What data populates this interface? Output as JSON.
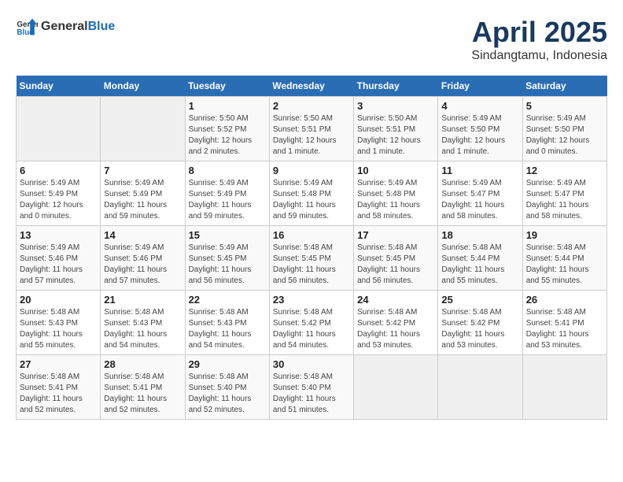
{
  "header": {
    "logo": {
      "general": "General",
      "blue": "Blue"
    },
    "title": "April 2025",
    "subtitle": "Sindangtamu, Indonesia"
  },
  "weekdays": [
    "Sunday",
    "Monday",
    "Tuesday",
    "Wednesday",
    "Thursday",
    "Friday",
    "Saturday"
  ],
  "weeks": [
    [
      {
        "day": "",
        "empty": true
      },
      {
        "day": "",
        "empty": true
      },
      {
        "day": "1",
        "sunrise": "Sunrise: 5:50 AM",
        "sunset": "Sunset: 5:52 PM",
        "daylight": "Daylight: 12 hours and 2 minutes."
      },
      {
        "day": "2",
        "sunrise": "Sunrise: 5:50 AM",
        "sunset": "Sunset: 5:51 PM",
        "daylight": "Daylight: 12 hours and 1 minute."
      },
      {
        "day": "3",
        "sunrise": "Sunrise: 5:50 AM",
        "sunset": "Sunset: 5:51 PM",
        "daylight": "Daylight: 12 hours and 1 minute."
      },
      {
        "day": "4",
        "sunrise": "Sunrise: 5:49 AM",
        "sunset": "Sunset: 5:50 PM",
        "daylight": "Daylight: 12 hours and 1 minute."
      },
      {
        "day": "5",
        "sunrise": "Sunrise: 5:49 AM",
        "sunset": "Sunset: 5:50 PM",
        "daylight": "Daylight: 12 hours and 0 minutes."
      }
    ],
    [
      {
        "day": "6",
        "sunrise": "Sunrise: 5:49 AM",
        "sunset": "Sunset: 5:49 PM",
        "daylight": "Daylight: 12 hours and 0 minutes."
      },
      {
        "day": "7",
        "sunrise": "Sunrise: 5:49 AM",
        "sunset": "Sunset: 5:49 PM",
        "daylight": "Daylight: 11 hours and 59 minutes."
      },
      {
        "day": "8",
        "sunrise": "Sunrise: 5:49 AM",
        "sunset": "Sunset: 5:49 PM",
        "daylight": "Daylight: 11 hours and 59 minutes."
      },
      {
        "day": "9",
        "sunrise": "Sunrise: 5:49 AM",
        "sunset": "Sunset: 5:48 PM",
        "daylight": "Daylight: 11 hours and 59 minutes."
      },
      {
        "day": "10",
        "sunrise": "Sunrise: 5:49 AM",
        "sunset": "Sunset: 5:48 PM",
        "daylight": "Daylight: 11 hours and 58 minutes."
      },
      {
        "day": "11",
        "sunrise": "Sunrise: 5:49 AM",
        "sunset": "Sunset: 5:47 PM",
        "daylight": "Daylight: 11 hours and 58 minutes."
      },
      {
        "day": "12",
        "sunrise": "Sunrise: 5:49 AM",
        "sunset": "Sunset: 5:47 PM",
        "daylight": "Daylight: 11 hours and 58 minutes."
      }
    ],
    [
      {
        "day": "13",
        "sunrise": "Sunrise: 5:49 AM",
        "sunset": "Sunset: 5:46 PM",
        "daylight": "Daylight: 11 hours and 57 minutes."
      },
      {
        "day": "14",
        "sunrise": "Sunrise: 5:49 AM",
        "sunset": "Sunset: 5:46 PM",
        "daylight": "Daylight: 11 hours and 57 minutes."
      },
      {
        "day": "15",
        "sunrise": "Sunrise: 5:49 AM",
        "sunset": "Sunset: 5:45 PM",
        "daylight": "Daylight: 11 hours and 56 minutes."
      },
      {
        "day": "16",
        "sunrise": "Sunrise: 5:48 AM",
        "sunset": "Sunset: 5:45 PM",
        "daylight": "Daylight: 11 hours and 56 minutes."
      },
      {
        "day": "17",
        "sunrise": "Sunrise: 5:48 AM",
        "sunset": "Sunset: 5:45 PM",
        "daylight": "Daylight: 11 hours and 56 minutes."
      },
      {
        "day": "18",
        "sunrise": "Sunrise: 5:48 AM",
        "sunset": "Sunset: 5:44 PM",
        "daylight": "Daylight: 11 hours and 55 minutes."
      },
      {
        "day": "19",
        "sunrise": "Sunrise: 5:48 AM",
        "sunset": "Sunset: 5:44 PM",
        "daylight": "Daylight: 11 hours and 55 minutes."
      }
    ],
    [
      {
        "day": "20",
        "sunrise": "Sunrise: 5:48 AM",
        "sunset": "Sunset: 5:43 PM",
        "daylight": "Daylight: 11 hours and 55 minutes."
      },
      {
        "day": "21",
        "sunrise": "Sunrise: 5:48 AM",
        "sunset": "Sunset: 5:43 PM",
        "daylight": "Daylight: 11 hours and 54 minutes."
      },
      {
        "day": "22",
        "sunrise": "Sunrise: 5:48 AM",
        "sunset": "Sunset: 5:43 PM",
        "daylight": "Daylight: 11 hours and 54 minutes."
      },
      {
        "day": "23",
        "sunrise": "Sunrise: 5:48 AM",
        "sunset": "Sunset: 5:42 PM",
        "daylight": "Daylight: 11 hours and 54 minutes."
      },
      {
        "day": "24",
        "sunrise": "Sunrise: 5:48 AM",
        "sunset": "Sunset: 5:42 PM",
        "daylight": "Daylight: 11 hours and 53 minutes."
      },
      {
        "day": "25",
        "sunrise": "Sunrise: 5:48 AM",
        "sunset": "Sunset: 5:42 PM",
        "daylight": "Daylight: 11 hours and 53 minutes."
      },
      {
        "day": "26",
        "sunrise": "Sunrise: 5:48 AM",
        "sunset": "Sunset: 5:41 PM",
        "daylight": "Daylight: 11 hours and 53 minutes."
      }
    ],
    [
      {
        "day": "27",
        "sunrise": "Sunrise: 5:48 AM",
        "sunset": "Sunset: 5:41 PM",
        "daylight": "Daylight: 11 hours and 52 minutes."
      },
      {
        "day": "28",
        "sunrise": "Sunrise: 5:48 AM",
        "sunset": "Sunset: 5:41 PM",
        "daylight": "Daylight: 11 hours and 52 minutes."
      },
      {
        "day": "29",
        "sunrise": "Sunrise: 5:48 AM",
        "sunset": "Sunset: 5:40 PM",
        "daylight": "Daylight: 11 hours and 52 minutes."
      },
      {
        "day": "30",
        "sunrise": "Sunrise: 5:48 AM",
        "sunset": "Sunset: 5:40 PM",
        "daylight": "Daylight: 11 hours and 51 minutes."
      },
      {
        "day": "",
        "empty": true
      },
      {
        "day": "",
        "empty": true
      },
      {
        "day": "",
        "empty": true
      }
    ]
  ]
}
